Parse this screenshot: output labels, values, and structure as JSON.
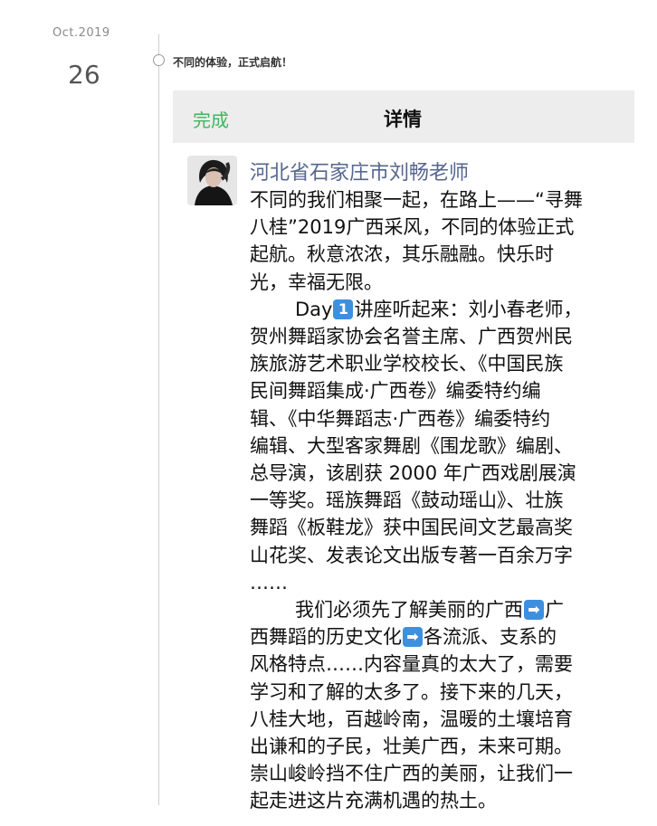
{
  "date": {
    "month": "Oct.2019",
    "day": "26"
  },
  "post": {
    "title": "不同的体验，正式启航！"
  },
  "header": {
    "done_label": "完成",
    "title": "详情"
  },
  "author": {
    "name": "河北省石家庄市刘畅老师"
  },
  "content": {
    "lines": [
      "不同的我们相聚一起，在路上——“寻舞",
      "八桂”2019广西采风，不同的体验正式",
      "起航。秋意浓浓，其乐融融。快乐时",
      "光，幸福无限。"
    ],
    "day_prefix": "Day",
    "day_badge": "1",
    "day_line_rest": "讲座听起来：刘小春老师，",
    "lines2": [
      "贺州舞蹈家协会名誉主席、广西贺州民",
      "族旅游艺术职业学校校长、《中国民族",
      "民间舞蹈集成·广西卷》编委特约编",
      "辑、《中华舞蹈志·广西卷》编委特约",
      "编辑、大型客家舞剧《围龙歌》编剧、",
      "总导演，该剧获 2000 年广西戏剧展演",
      "一等奖。瑶族舞蹈《鼓动瑶山》、壮族",
      "舞蹈《板鞋龙》获中国民间文艺最高奖",
      "山花奖、发表论文出版专著一百余万字",
      "……"
    ],
    "para2_part1": "我们必须先了解美丽的广西",
    "arrow_glyph": "➡",
    "para2_part2": "广",
    "para2_line2_part1": "西舞蹈的历史文化",
    "para2_line2_part2": "各流派、支系的",
    "lines3": [
      "风格特点……内容量真的太大了，需要",
      "学习和了解的太多了。接下来的几天，",
      "八桂大地，百越岭南，温暖的土壤培育",
      "出谦和的子民，壮美广西，未来可期。",
      "崇山峻岭挡不住广西的美丽，让我们一",
      "起走进这片充满机遇的热土。"
    ]
  },
  "colors": {
    "accent_green": "#43b45e",
    "author_blue": "#56668e",
    "header_bg": "#ededed"
  }
}
